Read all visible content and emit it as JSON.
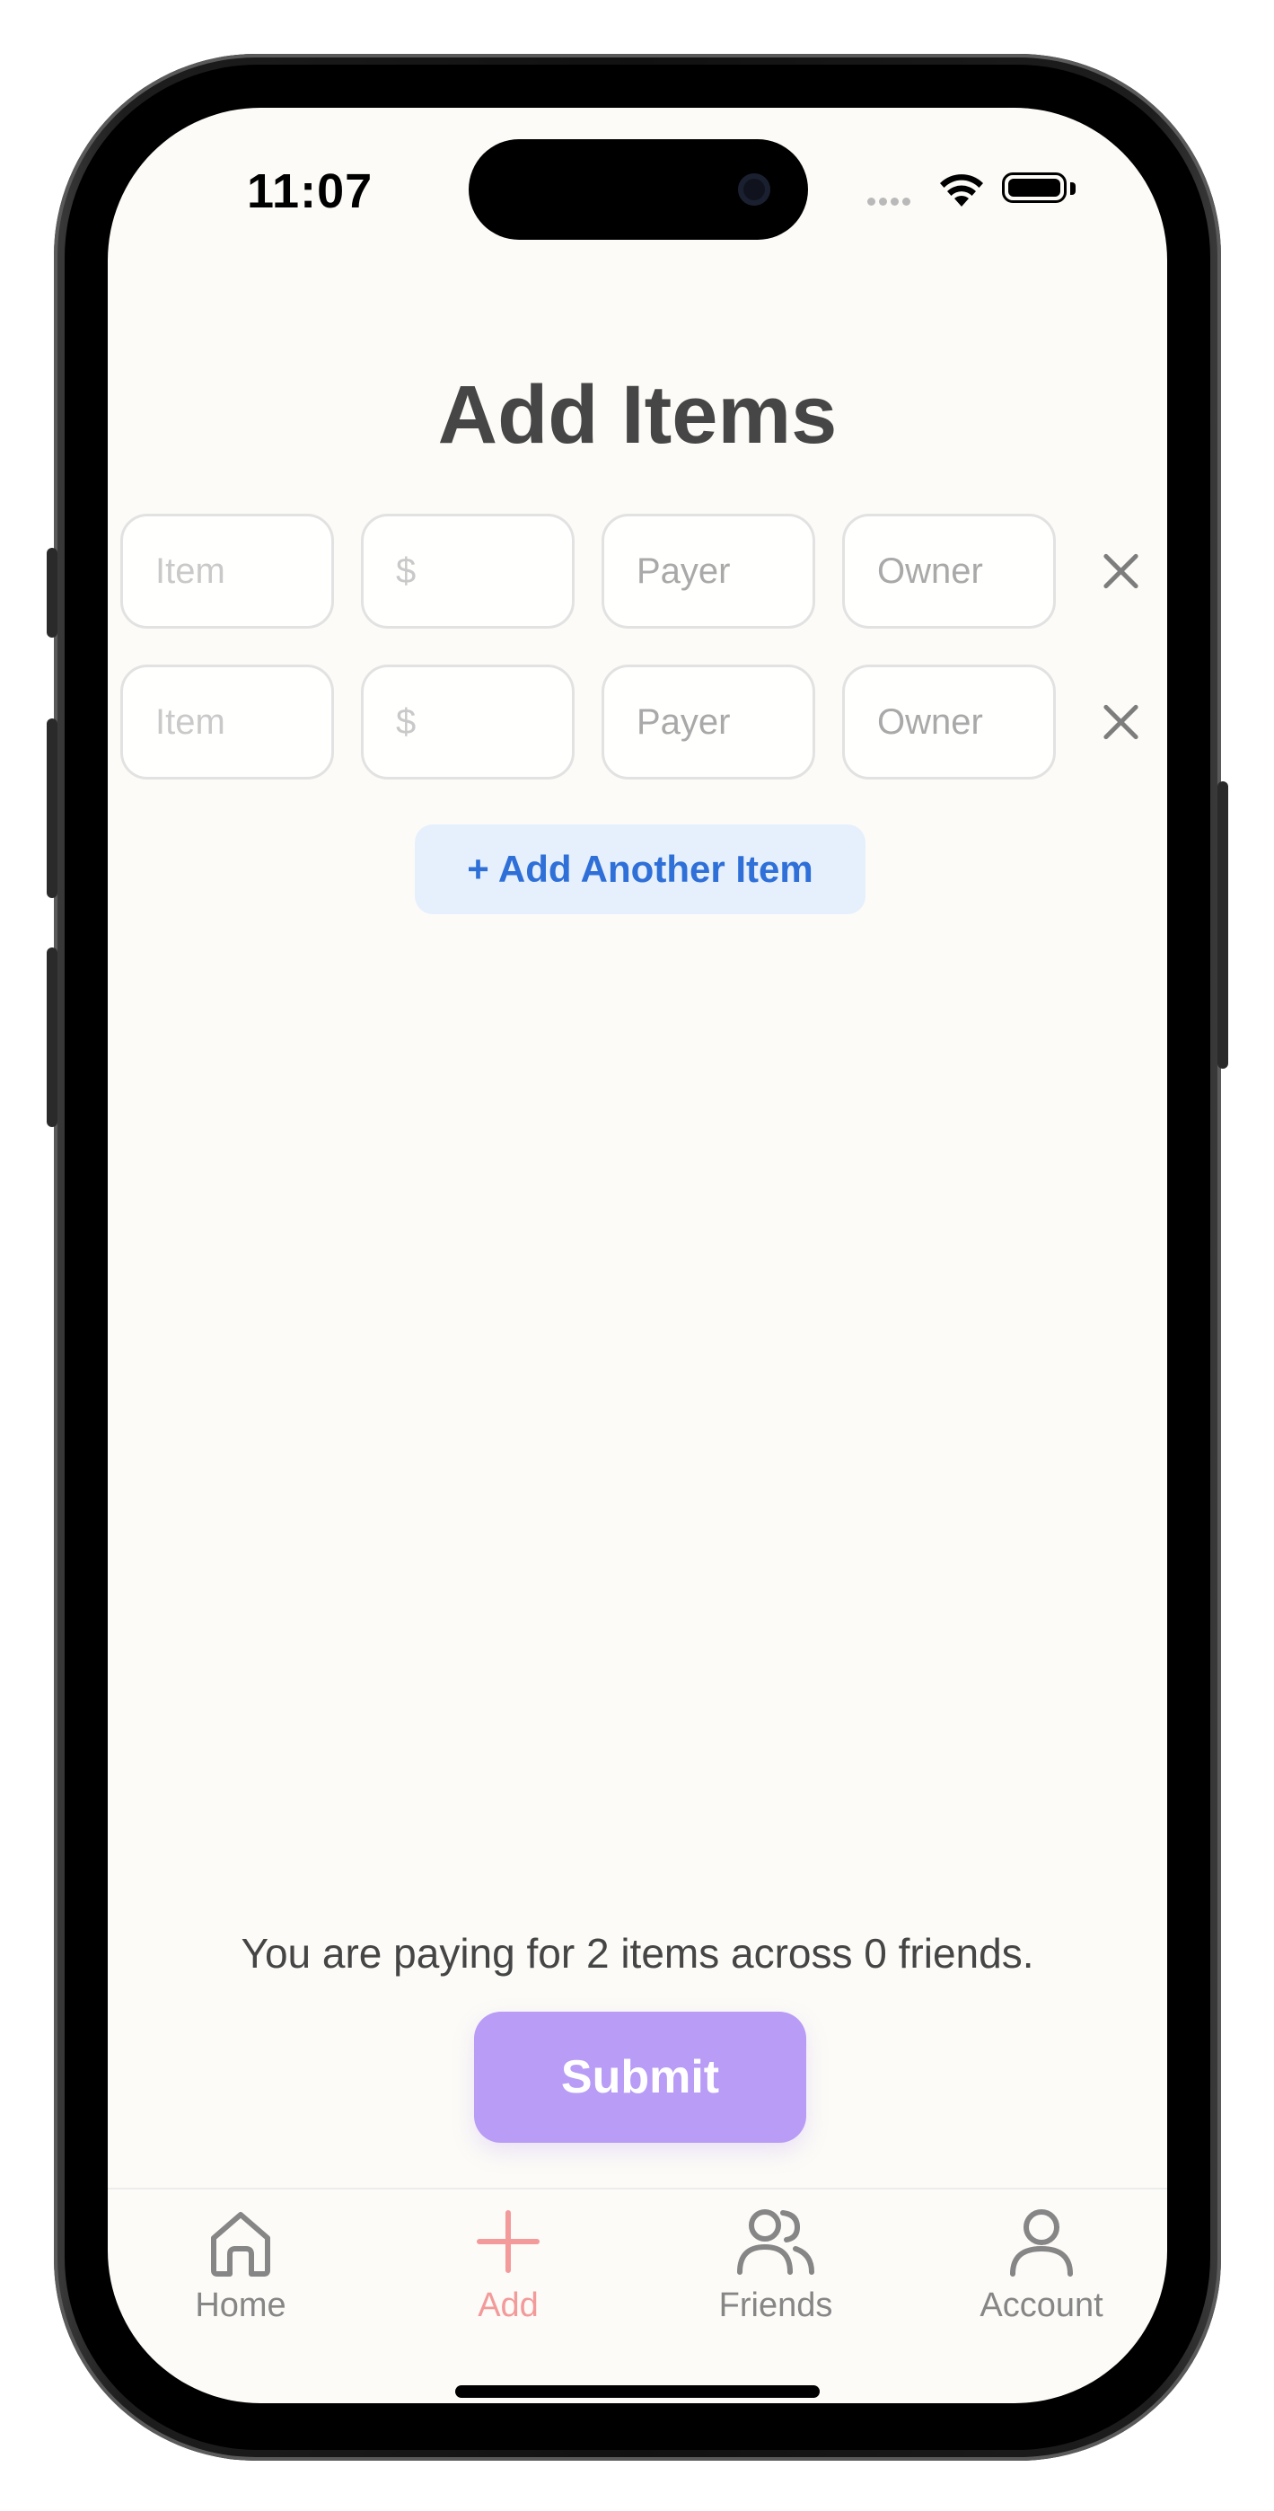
{
  "status_bar": {
    "time": "11:07"
  },
  "page": {
    "title": "Add Items"
  },
  "item_rows": [
    {
      "item_placeholder": "Item",
      "amount_placeholder": "$",
      "payer_placeholder": "Payer",
      "owner_placeholder": "Owner"
    },
    {
      "item_placeholder": "Item",
      "amount_placeholder": "$",
      "payer_placeholder": "Payer",
      "owner_placeholder": "Owner"
    }
  ],
  "actions": {
    "add_item_label": "+ Add Another Item",
    "submit_label": "Submit"
  },
  "summary": {
    "text": "You are paying for 2 items across 0 friends."
  },
  "tabs": [
    {
      "label": "Home",
      "icon": "home-icon"
    },
    {
      "label": "Add",
      "icon": "plus-icon",
      "active": true
    },
    {
      "label": "Friends",
      "icon": "friends-icon"
    },
    {
      "label": "Account",
      "icon": "account-icon"
    }
  ],
  "colors": {
    "background": "#fcfbf7",
    "accent_blue": "#2f6fd8",
    "submit_purple": "#b89cf5",
    "active_tab": "#f39a9a"
  }
}
